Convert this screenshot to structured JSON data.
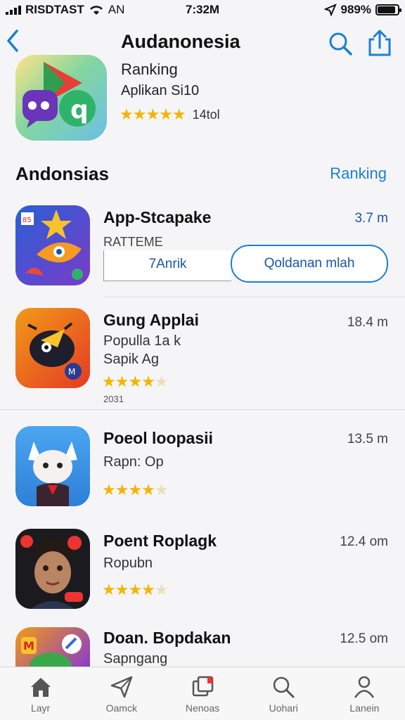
{
  "status": {
    "carrier": "RISDTAST",
    "network": "AN",
    "time": "7:32M",
    "battery": "989%",
    "battery_level": 0.9
  },
  "header": {
    "title": "Audanonesia",
    "subtitle": "Ranking",
    "category": "Aplikan Si10",
    "rating_count": "14tol",
    "rating": 5
  },
  "section": {
    "title": "Andonsias",
    "link": "Ranking"
  },
  "items": [
    {
      "name": "App-Stcapake",
      "size": "3.7 m",
      "label": "RATTEME",
      "button1": "7Anrik",
      "button2": "Qoldanan mlah"
    },
    {
      "name": "Gung Applai",
      "size": "18.4 m",
      "line1": "Populla 1a k",
      "line2": "Sapik Ag",
      "rating": 4,
      "note": "2031"
    },
    {
      "name": "Poeol loopasii",
      "size": "13.5 m",
      "line1": "Rapn: Op",
      "rating": 4
    },
    {
      "name": "Poent Roplagk",
      "size": "12.4 om",
      "line1": "Ropubn",
      "rating": 4
    },
    {
      "name": "Doan. Bopdakan",
      "size": "12.5 om",
      "line1": "Sapngang"
    }
  ],
  "tabs": [
    {
      "label": "Layr",
      "icon": "home-icon"
    },
    {
      "label": "Oamck",
      "icon": "paper-plane-icon"
    },
    {
      "label": "Nenoas",
      "icon": "stack-icon"
    },
    {
      "label": "Uohari",
      "icon": "search-icon"
    },
    {
      "label": "Lanein",
      "icon": "person-icon"
    }
  ],
  "colors": {
    "accent": "#1a7fd8",
    "star": "#f6b400",
    "background": "#f5f5f7"
  }
}
